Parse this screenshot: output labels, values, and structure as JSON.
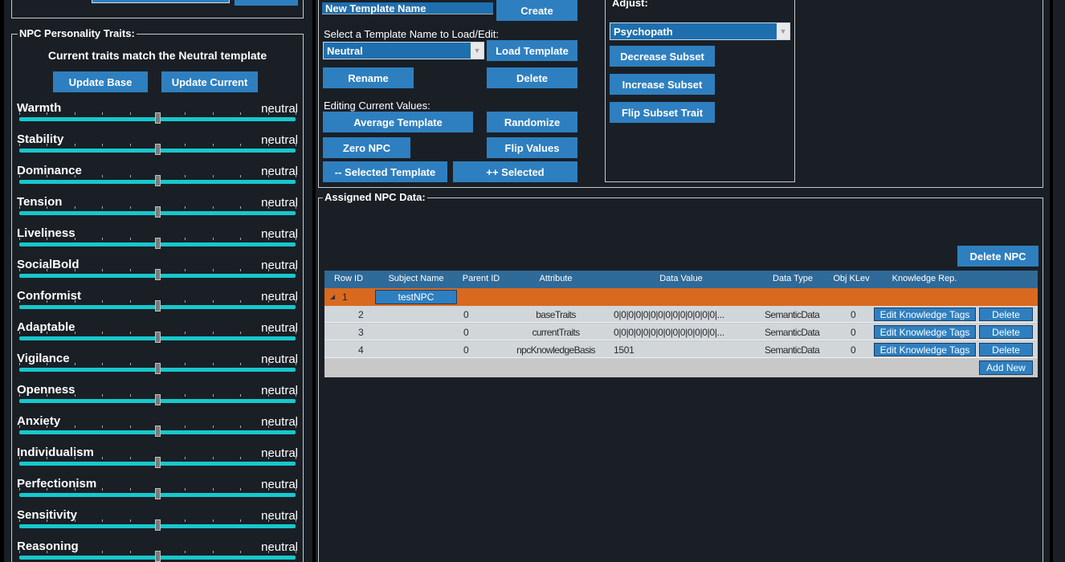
{
  "left": {
    "traits_legend": "NPC Personality Traits:",
    "status": "Current traits match the Neutral template",
    "update_base": "Update Base",
    "update_current": "Update Current",
    "traits": [
      {
        "name": "Warmth",
        "value": "neutral"
      },
      {
        "name": "Stability",
        "value": "neutral"
      },
      {
        "name": "Dominance",
        "value": "neutral"
      },
      {
        "name": "Tension",
        "value": "neutral"
      },
      {
        "name": "Liveliness",
        "value": "neutral"
      },
      {
        "name": "SocialBold",
        "value": "neutral"
      },
      {
        "name": "Conformist",
        "value": "neutral"
      },
      {
        "name": "Adaptable",
        "value": "neutral"
      },
      {
        "name": "Vigilance",
        "value": "neutral"
      },
      {
        "name": "Openness",
        "value": "neutral"
      },
      {
        "name": "Anxiety",
        "value": "neutral"
      },
      {
        "name": "Individualism",
        "value": "neutral"
      },
      {
        "name": "Perfectionism",
        "value": "neutral"
      },
      {
        "name": "Sensitivity",
        "value": "neutral"
      },
      {
        "name": "Reasoning",
        "value": "neutral"
      }
    ]
  },
  "templates": {
    "new_name_value": "New Template Name",
    "create": "Create",
    "select_label": "Select a Template Name to Load/Edit:",
    "selected": "Neutral",
    "load": "Load Template",
    "rename": "Rename",
    "delete": "Delete",
    "editing_label": "Editing Current Values:",
    "average": "Average Template",
    "randomize": "Randomize",
    "zero": "Zero NPC",
    "flip": "Flip Values",
    "minus_selected": "-- Selected Template",
    "plus_selected": "++ Selected"
  },
  "adjust": {
    "legend": "Adjust:",
    "selected": "Psychopath",
    "decrease": "Decrease Subset",
    "increase": "Increase Subset",
    "flip": "Flip Subset Trait"
  },
  "npc": {
    "legend": "Assigned NPC Data:",
    "delete_npc": "Delete NPC",
    "columns": [
      "Row ID",
      "Subject Name",
      "Parent ID",
      "Attribute",
      "Data Value",
      "Data Type",
      "Obj KLev",
      "Knowledge Rep."
    ],
    "parent_row": {
      "expander": "◢",
      "id": "1",
      "subject": "testNPC"
    },
    "rows": [
      {
        "id": "2",
        "parent": "0",
        "attribute": "baseTraits",
        "value": "0|0|0|0|0|0|0|0|0|0|0|0|0|0|...",
        "type": "SemanticData",
        "klev": "0",
        "edit": "Edit Knowledge Tags",
        "delete": "Delete"
      },
      {
        "id": "3",
        "parent": "0",
        "attribute": "currentTraits",
        "value": "0|0|0|0|0|0|0|0|0|0|0|0|0|0|...",
        "type": "SemanticData",
        "klev": "0",
        "edit": "Edit Knowledge Tags",
        "delete": "Delete"
      },
      {
        "id": "4",
        "parent": "0",
        "attribute": "npcKnowledgeBasis",
        "value": "1501",
        "type": "SemanticData",
        "klev": "0",
        "edit": "Edit Knowledge Tags",
        "delete": "Delete"
      }
    ],
    "add_new": "Add New"
  }
}
